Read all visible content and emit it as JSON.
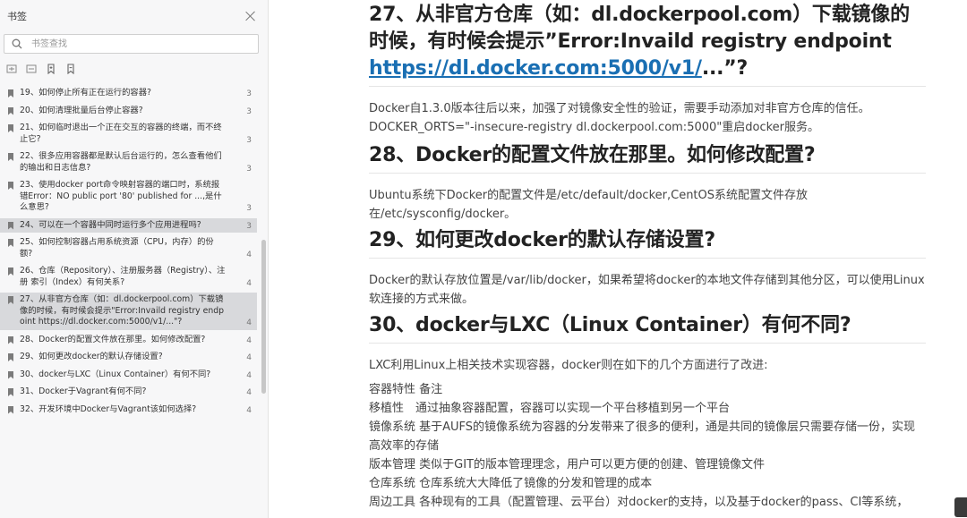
{
  "sidebar": {
    "title": "书签",
    "search_placeholder": "书签查找",
    "items": [
      {
        "label": "19、如何停止所有正在运行的容器?",
        "page": "3",
        "active": false
      },
      {
        "label": "20、如何清理批量后台停止容器?",
        "page": "3",
        "active": false
      },
      {
        "label": "21、如何临时退出一个正在交互的容器的终端，而不终止它?",
        "page": "3",
        "active": false
      },
      {
        "label": "22、很多应用容器都是默认后台运行的，怎么查看他们的输出和日志信息?",
        "page": "3",
        "active": false
      },
      {
        "label": "23、使用docker port命令映射容器的端口时，系统报错Error：NO public port '80' published for ...,是什么意思?",
        "page": "3",
        "active": false
      },
      {
        "label": "24、可以在一个容器中同时运行多个应用进程吗?",
        "page": "3",
        "active": true
      },
      {
        "label": "25、如何控制容器占用系统资源（CPU，内存）的份额?",
        "page": "4",
        "active": false
      },
      {
        "label": "26、仓库（Repository）、注册服务器（Registry）、注册 索引（Index）有何关系?",
        "page": "4",
        "active": false
      },
      {
        "label": "27、从非官方仓库（如：dl.dockerpool.com）下载镜像的时候，有时候会提示\"Error:Invaild registry endpoint https://dl.docker.com:5000/v1/...\"?",
        "page": "4",
        "active": true
      },
      {
        "label": "28、Docker的配置文件放在那里。如何修改配置?",
        "page": "4",
        "active": false
      },
      {
        "label": "29、如何更改docker的默认存储设置?",
        "page": "4",
        "active": false
      },
      {
        "label": "30、docker与LXC（Linux Container）有何不同?",
        "page": "4",
        "active": false
      },
      {
        "label": "31、Docker于Vagrant有何不同?",
        "page": "4",
        "active": false
      },
      {
        "label": "32、开发环境中Docker与Vagrant该如何选择?",
        "page": "4",
        "active": false
      }
    ]
  },
  "doc": {
    "h27_text": "27、从非官方仓库（如：dl.dockerpool.com）下载镜像的时候，有时候会提示”Error:Invaild registry endpoint ",
    "h27_link": "https://dl.docker.com:5000/v1/",
    "h27_tail": "...”?",
    "p27": "Docker自1.3.0版本往后以来，加强了对镜像安全性的验证，需要手动添加对非官方仓库的信任。DOCKER_ORTS=\"-insecure-registry dl.dockerpool.com:5000\"重启docker服务。",
    "h28": "28、Docker的配置文件放在那里。如何修改配置?",
    "p28": "Ubuntu系统下Docker的配置文件是/etc/default/docker,CentOS系统配置文件存放在/etc/sysconfig/docker。",
    "h29": "29、如何更改docker的默认存储设置?",
    "p29": "Docker的默认存放位置是/var/lib/docker，如果希望将docker的本地文件存储到其他分区，可以使用Linux软连接的方式来做。",
    "h30": "30、docker与LXC（Linux Container）有何不同?",
    "p30": "LXC利用Linux上相关技术实现容器，docker则在如下的几个方面进行了改进:",
    "table_lines": [
      "容器特性 备注",
      "移植性　通过抽象容器配置，容器可以实现一个平台移植到另一个平台",
      "镜像系统 基于AUFS的镜像系统为容器的分发带来了很多的便利，通是共同的镜像层只需要存储一份，实现高效率的存储",
      "版本管理 类似于GIT的版本管理理念，用户可以更方便的创建、管理镜像文件",
      "仓库系统 仓库系统大大降低了镜像的分发和管理的成本",
      "周边工具 各种现有的工具（配置管理、云平台）对docker的支持，以及基于docker的pass、CI等系统，"
    ]
  }
}
